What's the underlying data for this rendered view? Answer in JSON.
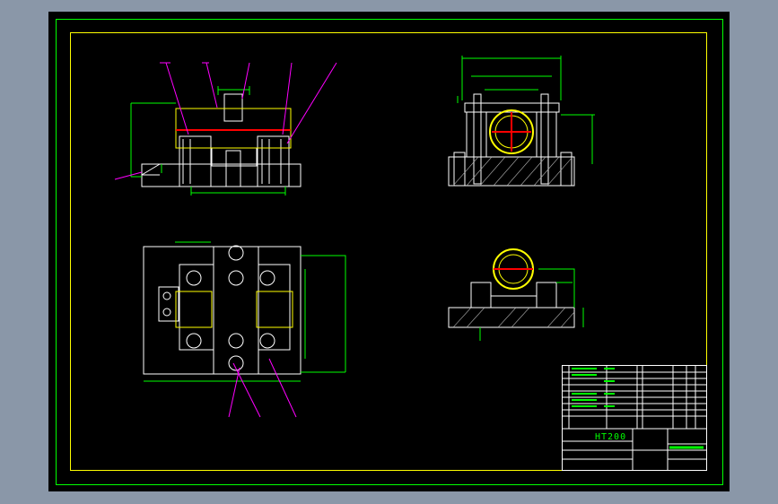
{
  "drawing": {
    "material": "HT200",
    "colors": {
      "background": "#000000",
      "frame": "#00ff00",
      "border": "#ffff00",
      "lines": "#ffffff",
      "dims": "#00ff00",
      "leaders": "#ff00ff",
      "center": "#ff0000"
    }
  }
}
